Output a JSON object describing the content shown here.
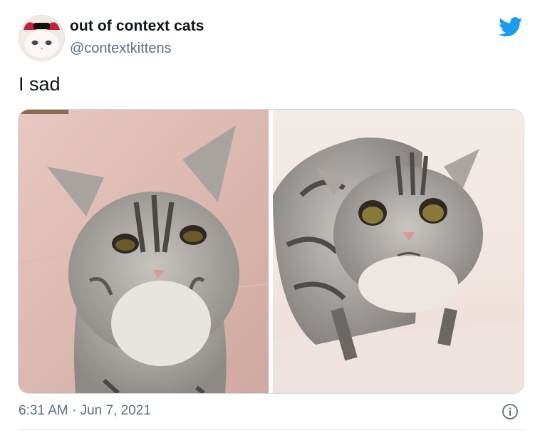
{
  "tweet": {
    "display_name": "out of context cats",
    "handle": "@contextkittens",
    "text": "I sad",
    "timestamp": "6:31 AM · Jun 7, 2021"
  },
  "icons": {
    "brand": "twitter-bird-icon",
    "info": "info-icon"
  },
  "colors": {
    "twitter_blue": "#1d9bf0",
    "secondary_text": "#5b7083",
    "primary_text": "#0f1419"
  }
}
